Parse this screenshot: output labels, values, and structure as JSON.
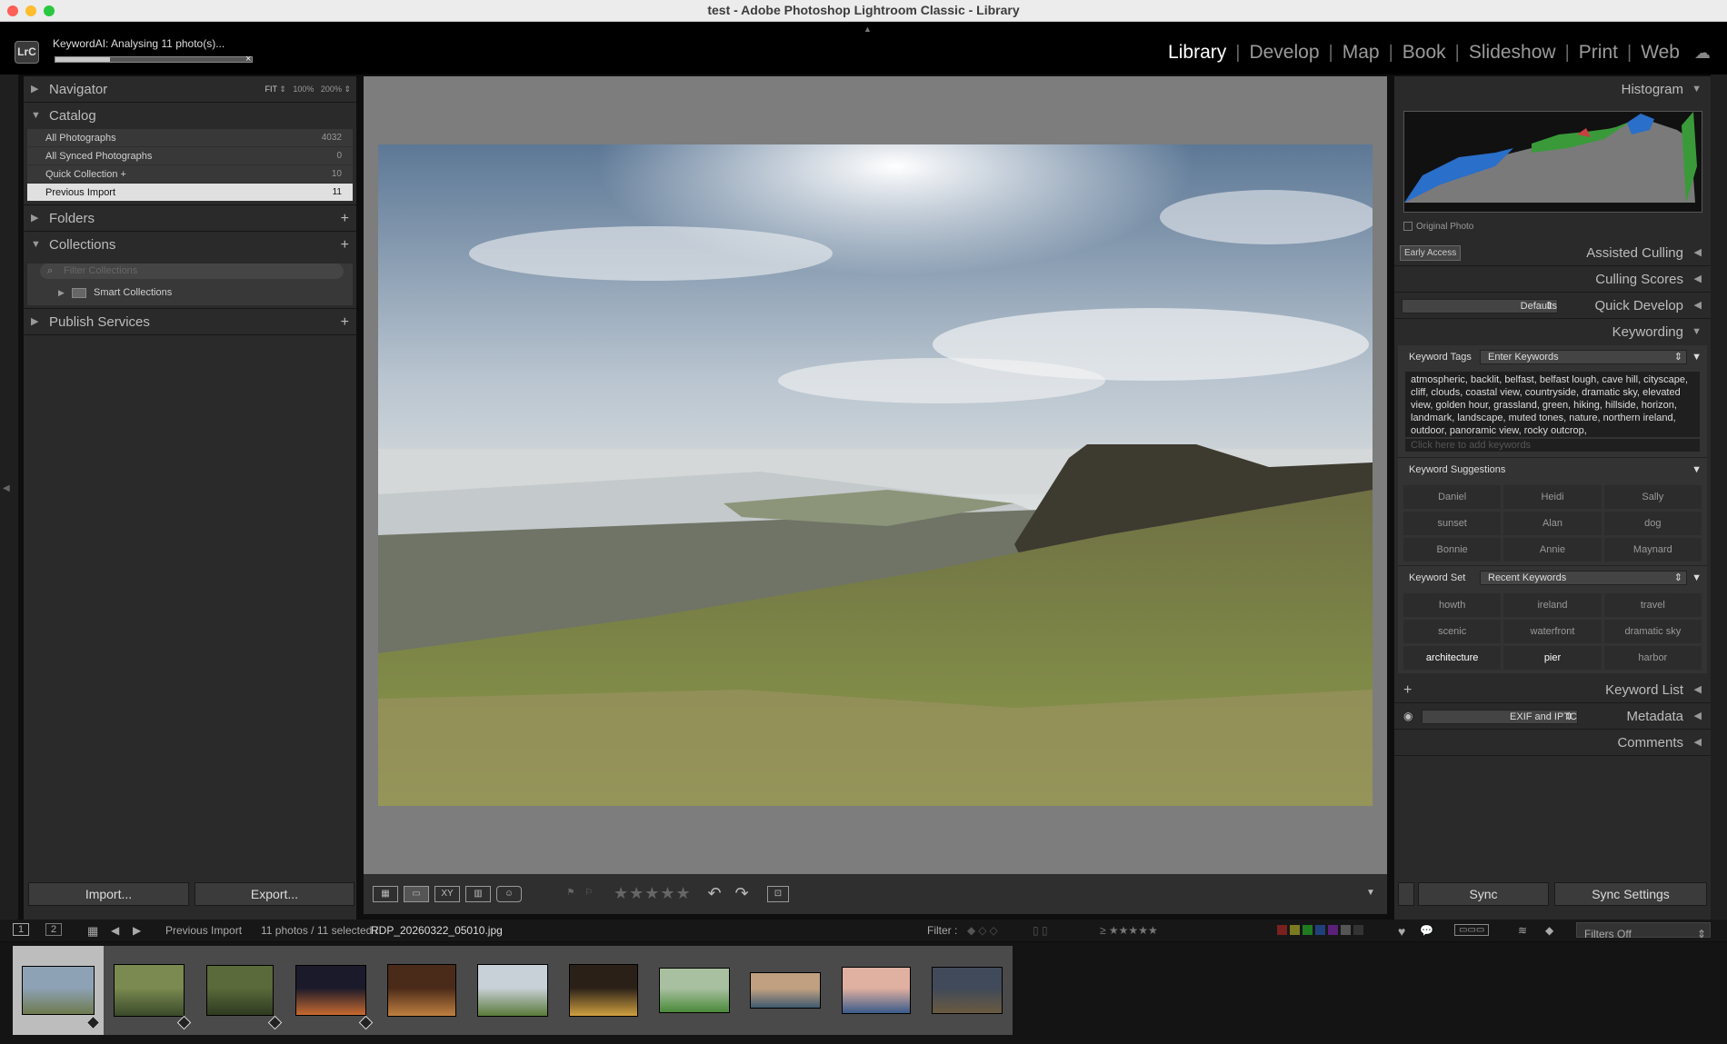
{
  "window": {
    "title": "test - Adobe Photoshop Lightroom Classic - Library"
  },
  "app": {
    "logo": "LrC"
  },
  "plugin": {
    "status": "KeywordAI: Analysing 11 photo(s)...",
    "progress": 0.28,
    "close_glyph": "×"
  },
  "modules": [
    "Library",
    "Develop",
    "Map",
    "Book",
    "Slideshow",
    "Print",
    "Web"
  ],
  "active_module": "Library",
  "left_panel": {
    "navigator": {
      "label": "Navigator",
      "zoom": [
        "FIT",
        "100%",
        "200%"
      ]
    },
    "catalog": {
      "label": "Catalog",
      "items": [
        {
          "label": "All Photographs",
          "count": "4032"
        },
        {
          "label": "All Synced Photographs",
          "count": "0"
        },
        {
          "label": "Quick Collection  +",
          "count": "10"
        },
        {
          "label": "Previous Import",
          "count": "11"
        }
      ]
    },
    "folders": {
      "label": "Folders"
    },
    "collections": {
      "label": "Collections",
      "filter_placeholder": "Filter Collections",
      "smart": "Smart Collections"
    },
    "publish": {
      "label": "Publish Services"
    },
    "import_label": "Import...",
    "export_label": "Export..."
  },
  "right_panel": {
    "histogram": {
      "label": "Histogram",
      "original_photo": "Original Photo"
    },
    "early_access": "Early Access",
    "assisted_culling": "Assisted Culling",
    "culling_scores": "Culling Scores",
    "quick_develop": {
      "label": "Quick Develop",
      "preset": "Defaults"
    },
    "keywording": {
      "label": "Keywording",
      "tags_label": "Keyword Tags",
      "tags_mode": "Enter Keywords",
      "keywords_text": "atmospheric, backlit, belfast, belfast lough, cave hill, cityscape, cliff, clouds, coastal view, countryside, dramatic sky, elevated view, golden hour, grassland, green, hiking, hillside, horizon, landmark, landscape, muted tones, nature, northern ireland, outdoor, panoramic view, rocky outcrop,",
      "add_placeholder": "Click here to add keywords",
      "suggestions_label": "Keyword Suggestions",
      "suggestions": [
        "Daniel",
        "Heidi",
        "Sally",
        "sunset",
        "Alan",
        "dog",
        "Bonnie",
        "Annie",
        "Maynard"
      ],
      "set_label": "Keyword Set",
      "set_value": "Recent Keywords",
      "set_items": [
        "howth",
        "ireland",
        "travel",
        "scenic",
        "waterfront",
        "dramatic sky",
        "architecture",
        "pier",
        "harbor"
      ]
    },
    "keyword_list": "Keyword List",
    "metadata": {
      "label": "Metadata",
      "preset": "EXIF and IPTC"
    },
    "comments": "Comments",
    "sync_label": "Sync",
    "sync_settings_label": "Sync Settings"
  },
  "filmstrip_bar": {
    "screen1": "1",
    "screen2": "2",
    "source": "Previous Import",
    "count": "11 photos / 11 selected /",
    "filename": "RDP_20260322_05010.jpg",
    "filter_label": "Filter :",
    "filters_off": "Filters Off"
  },
  "colors": {
    "accent_active": "#ffffff",
    "panel_bg": "#2a2a2a",
    "center_bg": "#7d7d7d"
  },
  "thumbnails": [
    {
      "selected": true,
      "badge": true
    },
    {
      "selected": true,
      "badge": true
    },
    {
      "selected": true,
      "badge": true
    },
    {
      "selected": true,
      "badge": true
    },
    {
      "selected": true,
      "badge": false
    },
    {
      "selected": true,
      "badge": false
    },
    {
      "selected": true,
      "badge": false
    },
    {
      "selected": true,
      "badge": false
    },
    {
      "selected": true,
      "badge": false
    },
    {
      "selected": true,
      "badge": false
    },
    {
      "selected": true,
      "badge": false
    }
  ]
}
